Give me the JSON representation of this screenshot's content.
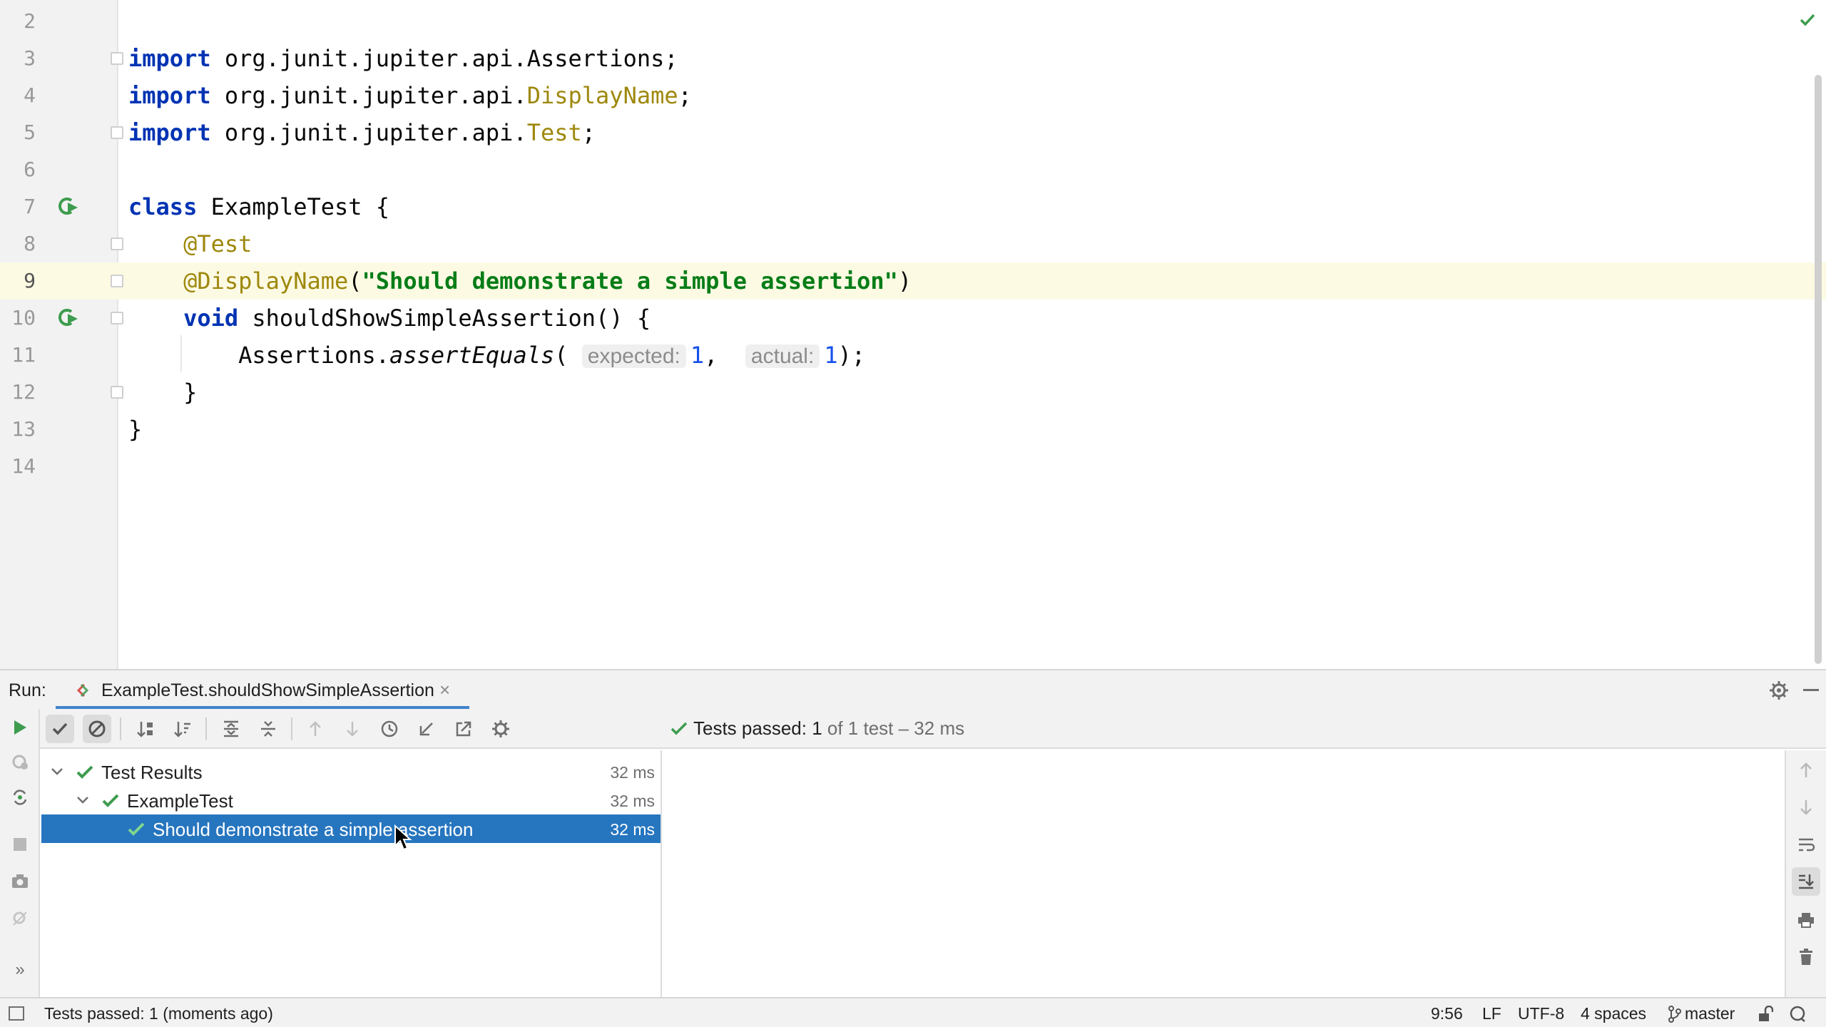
{
  "editor": {
    "lines": [
      {
        "num": "2"
      },
      {
        "num": "3",
        "tokens": [
          {
            "t": "import",
            "c": "kw"
          },
          {
            "t": " org.junit.jupiter.api.Assertions;"
          }
        ]
      },
      {
        "num": "4",
        "tokens": [
          {
            "t": "import",
            "c": "kw"
          },
          {
            "t": " org.junit.jupiter.api."
          },
          {
            "t": "DisplayName",
            "c": "ann"
          },
          {
            "t": ";"
          }
        ]
      },
      {
        "num": "5",
        "tokens": [
          {
            "t": "import",
            "c": "kw"
          },
          {
            "t": " org.junit.jupiter.api."
          },
          {
            "t": "Test",
            "c": "ann"
          },
          {
            "t": ";"
          }
        ]
      },
      {
        "num": "6"
      },
      {
        "num": "7",
        "tokens": [
          {
            "t": "class",
            "c": "kw"
          },
          {
            "t": " ExampleTest {"
          }
        ]
      },
      {
        "num": "8",
        "tokens": [
          {
            "t": "    "
          },
          {
            "t": "@Test",
            "c": "ann"
          }
        ]
      },
      {
        "num": "9",
        "current": true,
        "tokens": [
          {
            "t": "    "
          },
          {
            "t": "@DisplayName",
            "c": "ann"
          },
          {
            "t": "("
          },
          {
            "t": "\"Should demonstrate a simple assertion\"",
            "c": "str"
          },
          {
            "t": ")"
          }
        ]
      },
      {
        "num": "10",
        "tokens": [
          {
            "t": "    "
          },
          {
            "t": "void",
            "c": "kw"
          },
          {
            "t": " shouldShowSimpleAssertion() {"
          }
        ]
      },
      {
        "num": "11",
        "tokens": [
          {
            "t": "        Assertions."
          },
          {
            "t": "assertEquals",
            "c": "ital"
          },
          {
            "t": "( "
          },
          {
            "t": "expected:",
            "c": "hint"
          },
          {
            "t": "1",
            "c": "num"
          },
          {
            "t": ",  "
          },
          {
            "t": "actual:",
            "c": "hint"
          },
          {
            "t": "1",
            "c": "num"
          },
          {
            "t": ");"
          }
        ]
      },
      {
        "num": "12",
        "tokens": [
          {
            "t": "    }"
          }
        ]
      },
      {
        "num": "13",
        "tokens": [
          {
            "t": "}"
          }
        ]
      },
      {
        "num": "14"
      }
    ],
    "run_gutter_lines": [
      "7",
      "10"
    ],
    "inspection_icon": "check-icon"
  },
  "run_window": {
    "label": "Run:",
    "tab_label": "ExampleTest.shouldShowSimpleAssertion",
    "tab_close": "×",
    "summary_prefix": "Tests passed: ",
    "summary_count": "1",
    "summary_rest": " of 1 test – 32 ms",
    "tree": [
      {
        "label": "Test Results",
        "duration": "32 ms",
        "level": 0,
        "expanded": true
      },
      {
        "label": "ExampleTest",
        "duration": "32 ms",
        "level": 1,
        "expanded": true
      },
      {
        "label": "Should demonstrate a simple assertion",
        "duration": "32 ms",
        "level": 2,
        "selected": true
      }
    ]
  },
  "statusbar": {
    "message": "Tests passed: 1 (moments ago)",
    "position": "9:56",
    "line_separator": "LF",
    "encoding": "UTF-8",
    "indent": "4 spaces",
    "branch": "master"
  },
  "colors": {
    "selection": "#2675bf",
    "pass_green": "#3d9c4e",
    "tab_underline": "#4083c9",
    "current_line": "#fcfae3"
  }
}
